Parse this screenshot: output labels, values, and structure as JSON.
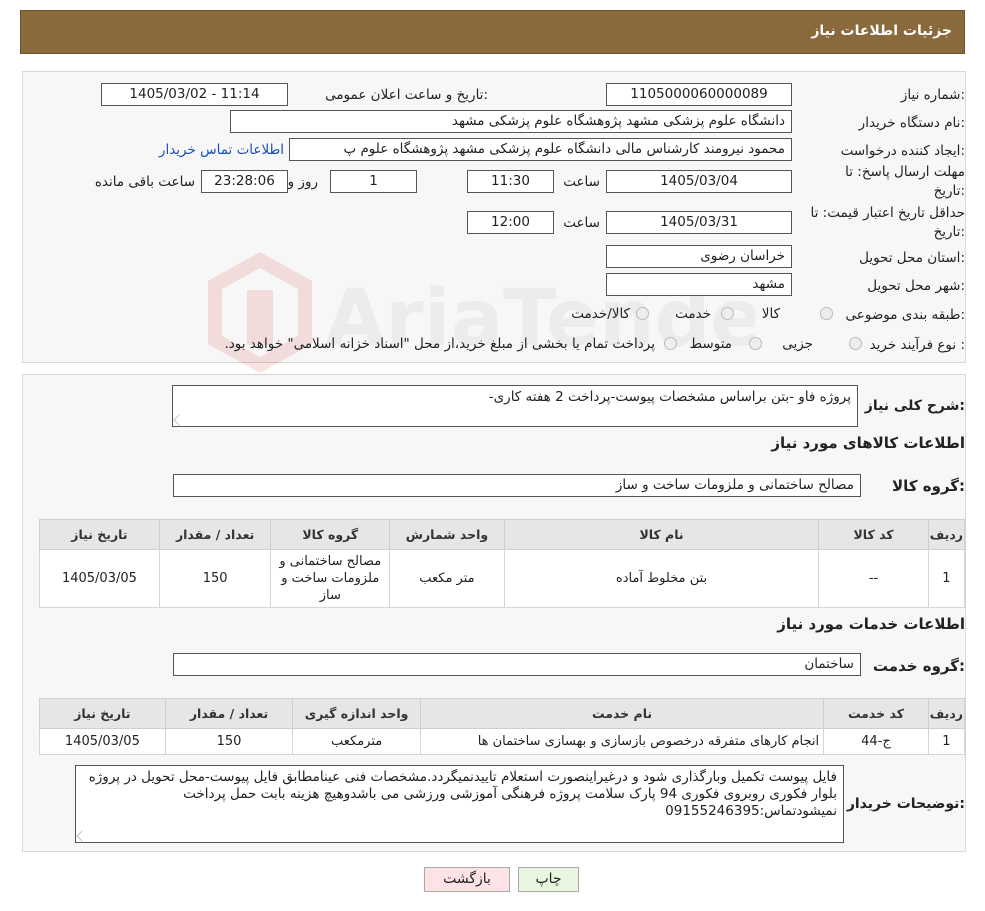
{
  "header": {
    "title": "جزئیات اطلاعات نیاز"
  },
  "fields": {
    "need_number_label": "شماره نیاز:",
    "need_number": "1105000060000089",
    "announce_label": "تاریخ و ساعت اعلان عمومی:",
    "announce_value": "1405/03/02 - 11:14",
    "buyer_label": "نام دستگاه خریدار:",
    "buyer_value": "دانشگاه علوم پزشکی مشهد   پژوهشگاه علوم پزشکی مشهد",
    "creator_label": "ایجاد کننده درخواست:",
    "creator_value": "محمود نیرومند کارشناس مالی دانشگاه علوم پزشکی مشهد   پژوهشگاه علوم پ",
    "contact_link": "اطلاعات تماس خریدار",
    "deadline_label_1": "مهلت ارسال پاسخ: تا",
    "deadline_label_2": "تاریخ:",
    "deadline_date": "1405/03/04",
    "deadline_time_label": "ساعت",
    "deadline_time": "11:30",
    "remaining_days": "1",
    "remaining_days_label": "روز و",
    "remaining_time": "23:28:06",
    "remaining_label": "ساعت باقی مانده",
    "validity_label_1": "حداقل تاریخ اعتبار قیمت: تا",
    "validity_label_2": "تاریخ:",
    "validity_date": "1405/03/31",
    "validity_time_label": "ساعت",
    "validity_time": "12:00",
    "province_label": "استان محل تحویل:",
    "province_value": "خراسان رضوی",
    "city_label": "شهر محل تحویل:",
    "city_value": "مشهد",
    "category_label": "طبقه بندی موضوعی:",
    "category_options": [
      "کالا",
      "خدمت",
      "کالا/خدمت"
    ],
    "process_label": "نوع فرآیند خرید :",
    "process_options": [
      "جزیی",
      "متوسط"
    ],
    "process_note": "پرداخت تمام یا بخشی از مبلغ خرید،از محل \"اسناد خزانه اسلامی\" خواهد بود."
  },
  "summary": {
    "desc_label": "شرح کلی نیاز:",
    "desc_value": "پروژه فاو -بتن براساس مشخصات پیوست-پرداخت 2 هفته کاری-",
    "goods_title": "اطلاعات کالاهای مورد نیاز",
    "goods_group_label": "گروه کالا:",
    "goods_group_value": "مصالح ساختمانی و ملزومات ساخت و ساز",
    "goods_headers": [
      "ردیف",
      "کد کالا",
      "نام کالا",
      "واحد شمارش",
      "گروه کالا",
      "تعداد / مقدار",
      "تاریخ نیاز"
    ],
    "goods_rows": [
      [
        "1",
        "--",
        "بتن مخلوط آماده",
        "متر مکعب",
        "مصالح ساختمانی و ملزومات ساخت و ساز",
        "150",
        "1405/03/05"
      ]
    ],
    "services_title": "اطلاعات خدمات مورد نیاز",
    "service_group_label": "گروه خدمت:",
    "service_group_value": "ساختمان",
    "services_headers": [
      "ردیف",
      "کد خدمت",
      "نام خدمت",
      "واحد اندازه گیری",
      "تعداد / مقدار",
      "تاریخ نیاز"
    ],
    "services_rows": [
      [
        "1",
        "ج-44",
        "انجام کارهای متفرقه درخصوص بازسازی و بهسازی ساختمان ها",
        "مترمکعب",
        "150",
        "1405/03/05"
      ]
    ],
    "buyer_notes_label": "توضیحات خریدار:",
    "buyer_notes_value": "فایل پیوست تکمیل وبارگذاری شود و درغیراینصورت استعلام تاییدنمیگردد.مشخصات فنی عینامطابق فایل پیوست-محل تحویل در پروژه بلوار فکوری روبروی فکوری 94 پارک سلامت پروژه فرهنگی آموزشی ورزشی می باشدوهیچ هزینه بابت حمل پرداخت نمیشودتماس:09155246395"
  },
  "buttons": {
    "print": "چاپ",
    "back": "بازگشت"
  },
  "watermark": {
    "text": "AriaTender.neT"
  },
  "colors": {
    "header": "#8a6a3c",
    "back_button": "#fde3e6",
    "print_button": "#e9f7e1",
    "link": "#1a4fb5"
  }
}
